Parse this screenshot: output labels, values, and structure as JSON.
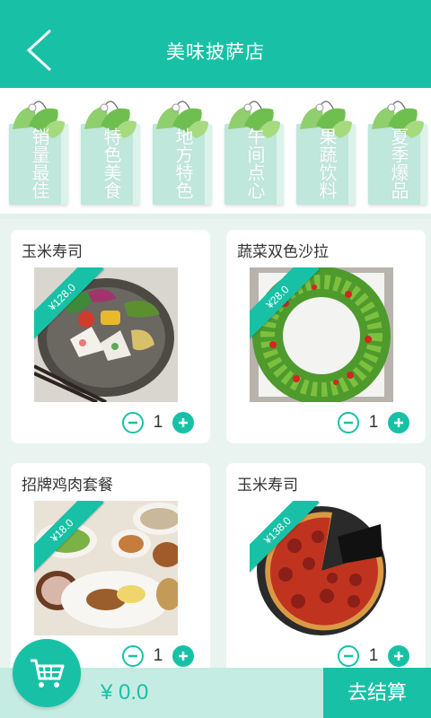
{
  "header": {
    "title": "美味披萨店",
    "back_icon": "back-arrow-icon"
  },
  "categories": [
    {
      "label": "销量最佳",
      "chars": [
        "销",
        "量",
        "最",
        "佳"
      ]
    },
    {
      "label": "特色美食",
      "chars": [
        "特",
        "色",
        "美",
        "食"
      ]
    },
    {
      "label": "地方特色",
      "chars": [
        "地",
        "方",
        "特",
        "色"
      ]
    },
    {
      "label": "午间点心",
      "chars": [
        "午",
        "间",
        "点",
        "心"
      ]
    },
    {
      "label": "果蔬饮料",
      "chars": [
        "果",
        "蔬",
        "饮",
        "料"
      ]
    },
    {
      "label": "夏季爆品",
      "chars": [
        "夏",
        "季",
        "爆",
        "品"
      ]
    }
  ],
  "products": [
    {
      "name": "玉米寿司",
      "price": "¥128.0",
      "qty": "1",
      "image": "sushi-plate-photo"
    },
    {
      "name": "蔬菜双色沙拉",
      "price": "¥28.0",
      "qty": "1",
      "image": "salad-wreath-photo"
    },
    {
      "name": "招牌鸡肉套餐",
      "price": "¥18.0",
      "qty": "1",
      "image": "chicken-set-meal-photo"
    },
    {
      "name": "玉米寿司",
      "price": "¥138.0",
      "qty": "1",
      "image": "pizza-photo"
    }
  ],
  "cart": {
    "total": "¥ 0.0",
    "checkout_label": "去结算",
    "icon": "shopping-cart-icon"
  },
  "colors": {
    "accent": "#18c1a6",
    "tag_card": "#bfe7db",
    "bottom_bar": "#c5ece3",
    "background": "#e9f4f1"
  }
}
